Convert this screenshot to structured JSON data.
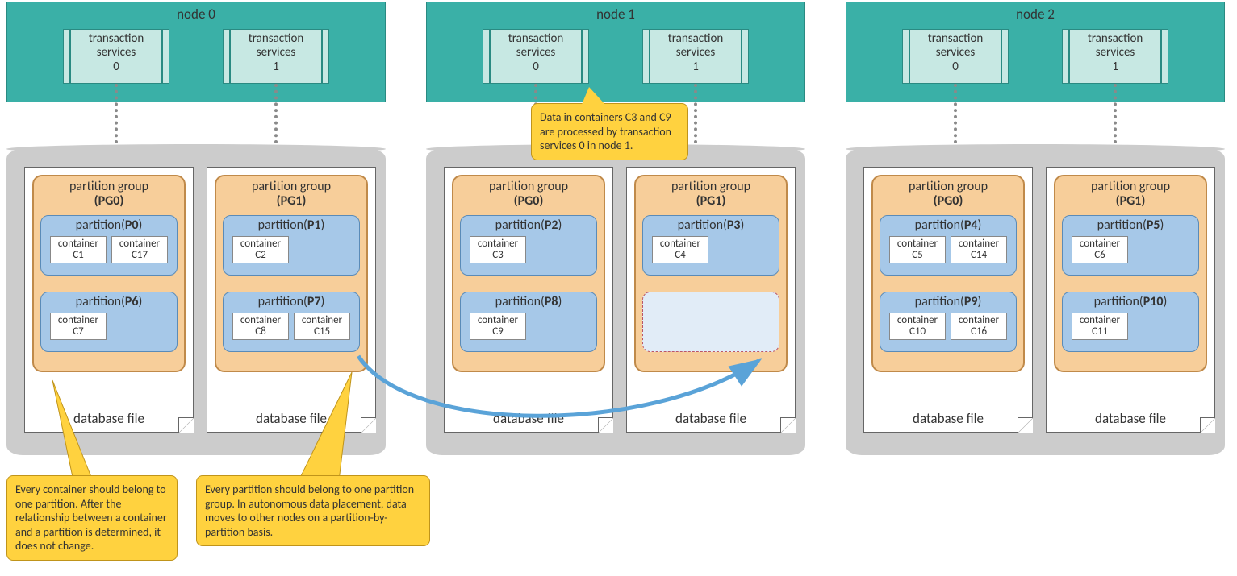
{
  "nodes": [
    {
      "title": "node 0",
      "ts0": "transaction\nservices\n0",
      "ts1": "transaction\nservices\n1",
      "pg0": {
        "label": "partition group",
        "name": "(PG0)",
        "pt": [
          {
            "label": "partition(P0)",
            "cn": [
              {
                "t": "container\nC1"
              },
              {
                "t": "container\nC17"
              }
            ]
          },
          {
            "label": "partition(P6)",
            "cn": [
              {
                "t": "container\nC7"
              }
            ]
          }
        ]
      },
      "pg1": {
        "label": "partition group",
        "name": "(PG1)",
        "pt": [
          {
            "label": "partition(P1)",
            "cn": [
              {
                "t": "container\nC2"
              }
            ]
          },
          {
            "label": "partition(P7)",
            "cn": [
              {
                "t": "container\nC8"
              },
              {
                "t": "container\nC15"
              }
            ]
          }
        ]
      },
      "db": "database file"
    },
    {
      "title": "node 1",
      "ts0": "transaction\nservices\n0",
      "ts1": "transaction\nservices\n1",
      "pg0": {
        "label": "partition group",
        "name": "(PG0)",
        "pt": [
          {
            "label": "partition(P2)",
            "cn": [
              {
                "t": "container\nC3"
              }
            ]
          },
          {
            "label": "partition(P8)",
            "cn": [
              {
                "t": "container\nC9"
              }
            ]
          }
        ]
      },
      "pg1": {
        "label": "partition group",
        "name": "(PG1)",
        "pt": [
          {
            "label": "partition(P3)",
            "cn": [
              {
                "t": "container\nC4"
              }
            ]
          },
          {
            "label": "",
            "dashed": true,
            "cn": []
          }
        ]
      },
      "db": "database file"
    },
    {
      "title": "node 2",
      "ts0": "transaction\nservices\n0",
      "ts1": "transaction\nservices\n1",
      "pg0": {
        "label": "partition group",
        "name": "(PG0)",
        "pt": [
          {
            "label": "partition(P4)",
            "cn": [
              {
                "t": "container\nC5"
              },
              {
                "t": "container\nC14"
              }
            ]
          },
          {
            "label": "partition(P9)",
            "cn": [
              {
                "t": "container\nC10"
              },
              {
                "t": "container\nC16"
              }
            ]
          }
        ]
      },
      "pg1": {
        "label": "partition group",
        "name": "(PG1)",
        "pt": [
          {
            "label": "partition(P5)",
            "cn": [
              {
                "t": "container\nC6"
              }
            ]
          },
          {
            "label": "partition(P10)",
            "cn": [
              {
                "t": "container\nC11"
              }
            ]
          }
        ]
      },
      "db": "database file"
    }
  ],
  "callouts": {
    "c1": "Data in containers C3 and C9 are processed by transaction services 0 in node 1.",
    "c2": "Every container should belong to one partition. After the relationship between a container and a partition is determined, it does not change.",
    "c3": "Every partition should belong to one partition group. In autonomous data placement, data moves to other nodes on a partition-by-partition basis."
  }
}
